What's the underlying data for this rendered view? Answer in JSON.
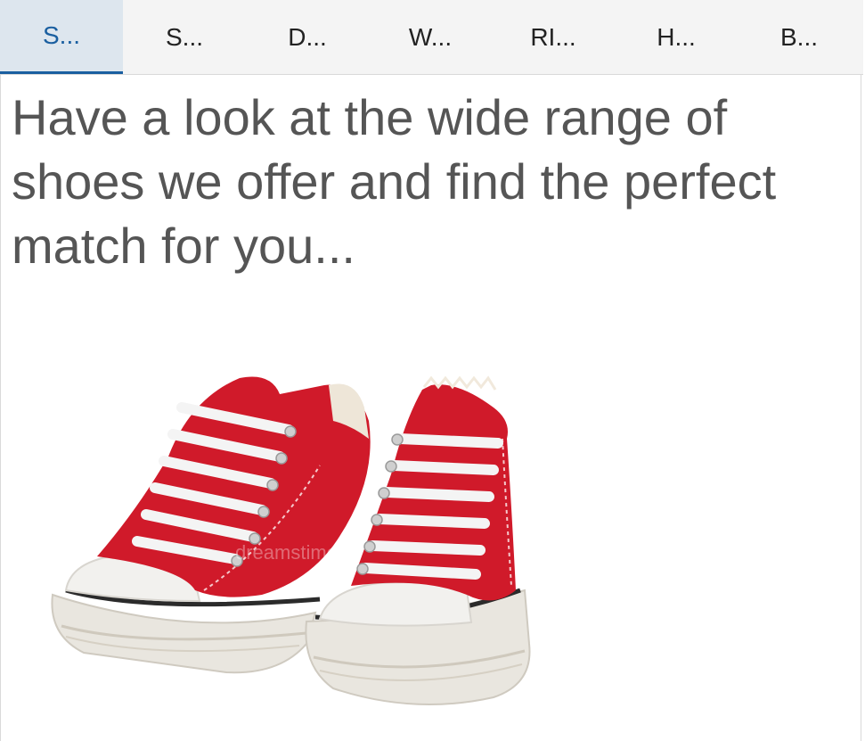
{
  "tabs": [
    {
      "label": "S..."
    },
    {
      "label": "S..."
    },
    {
      "label": "D..."
    },
    {
      "label": "W..."
    },
    {
      "label": "RI..."
    },
    {
      "label": "H..."
    },
    {
      "label": "B..."
    }
  ],
  "active_tab_index": 0,
  "content": {
    "headline": "Have a look at the wide range of shoes we offer and find the perfect match for you...",
    "image": {
      "alt": "Pair of red canvas sneakers",
      "watermark": "dreamstime"
    }
  },
  "colors": {
    "accent": "#1a5fa0",
    "active_tab_bg": "#dde6ee",
    "headline": "#555555",
    "shoe_red": "#d01a2a"
  }
}
